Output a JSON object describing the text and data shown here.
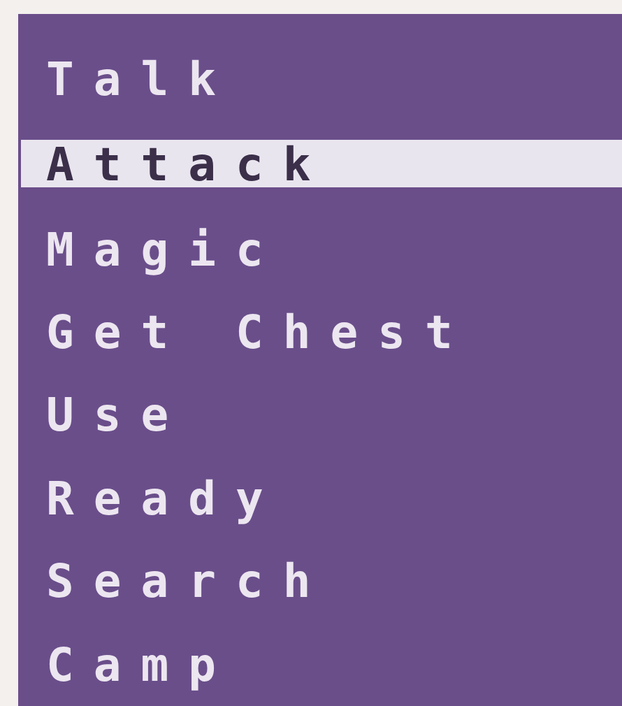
{
  "menu": {
    "items": [
      {
        "label": "Talk",
        "selected": false
      },
      {
        "label": "Attack",
        "selected": true
      },
      {
        "label": "Magic",
        "selected": false
      },
      {
        "label": "Get Chest",
        "selected": false
      },
      {
        "label": "Use",
        "selected": false
      },
      {
        "label": "Ready",
        "selected": false
      },
      {
        "label": "Search",
        "selected": false
      },
      {
        "label": "Camp",
        "selected": false
      }
    ]
  }
}
